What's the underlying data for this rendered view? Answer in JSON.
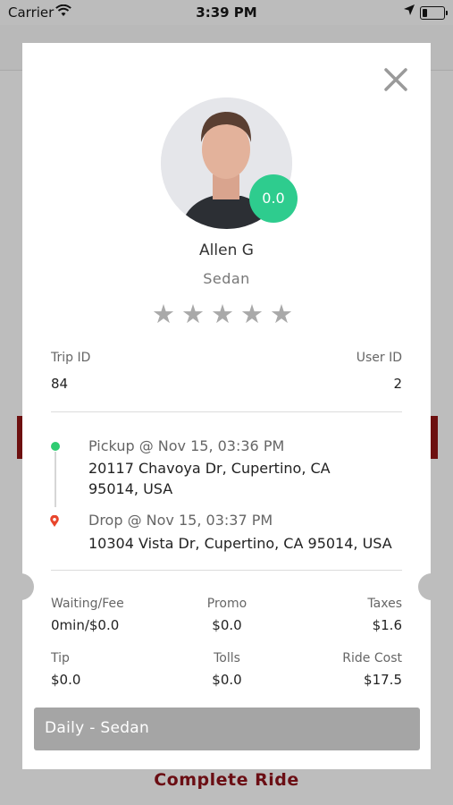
{
  "status_bar": {
    "carrier": "Carrier",
    "time": "3:39 PM"
  },
  "driver": {
    "name": "Allen G",
    "vehicle": "Sedan",
    "rating": "0.0",
    "stars_filled": 0,
    "stars_total": 5
  },
  "trip": {
    "trip_id_label": "Trip ID",
    "trip_id": "84",
    "user_id_label": "User ID",
    "user_id": "2"
  },
  "route": {
    "pickup_title": "Pickup @ Nov 15, 03:36 PM",
    "pickup_address_line1": "20117 Chavoya Dr, Cupertino, CA",
    "pickup_address_line2": "95014, USA",
    "drop_title": "Drop @ Nov 15, 03:37 PM",
    "drop_address": "10304 Vista Dr, Cupertino, CA 95014, USA"
  },
  "fees": {
    "waiting_label": "Waiting/Fee",
    "waiting_value": "0min/$0.0",
    "promo_label": "Promo",
    "promo_value": "$0.0",
    "taxes_label": "Taxes",
    "taxes_value": "$1.6",
    "tip_label": "Tip",
    "tip_value": "$0.0",
    "tolls_label": "Tolls",
    "tolls_value": "$0.0",
    "ride_cost_label": "Ride Cost",
    "ride_cost_value": "$17.5"
  },
  "plan_label": "Daily - Sedan",
  "complete_button": "Complete Ride",
  "colors": {
    "accent_green": "#2ecc8e",
    "drop_pin": "#e8452c",
    "complete_text": "#6b0e14"
  }
}
